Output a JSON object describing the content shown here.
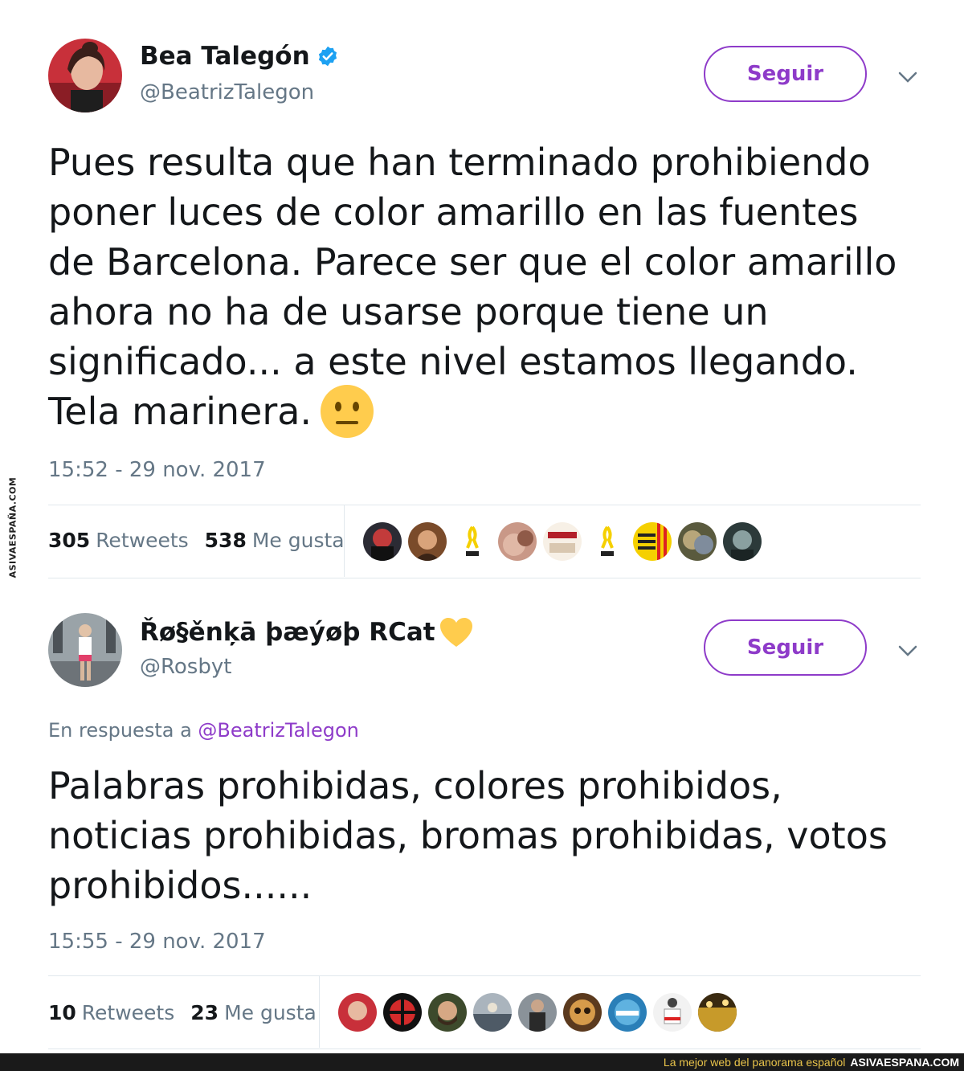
{
  "tweets": [
    {
      "name": "Bea Talegón",
      "handle": "@BeatrizTalegon",
      "follow_label": "Seguir",
      "text": "Pues resulta que han terminado prohibiendo\nponer luces de color amarillo en las fuentes\nde Barcelona. Parece ser que el color amarillo\nahora no ha de usarse porque tiene un\nsignificado... a este nivel estamos llegando.\nTela marinera.",
      "emoji": "neutral-face-icon",
      "timestamp": "15:52 - 29 nov. 2017",
      "retweets_count": "305",
      "retweets_label": "Retweets",
      "likes_count": "538",
      "likes_label": "Me gusta"
    },
    {
      "name": "Řø§ěnķā þæýøþ RCat",
      "handle": "@Rosbyt",
      "follow_label": "Seguir",
      "reply_prefix": "En respuesta a",
      "reply_mention": "@BeatrizTalegon",
      "text": "Palabras prohibidas, colores prohibidos,\nnoticias prohibidas, bromas prohibidas, votos\nprohibidos......",
      "timestamp": "15:55 - 29 nov. 2017",
      "retweets_count": "10",
      "retweets_label": "Retweets",
      "likes_count": "23",
      "likes_label": "Me gusta"
    }
  ],
  "watermark": {
    "side_text": "ASIVAESPAÑA.COM",
    "footer_tagline": "La mejor web del panorama español",
    "footer_site": "ASIVAESPANA.COM"
  },
  "colors": {
    "accent": "#8e3bc9",
    "muted": "#657786",
    "verified": "#1da1f2",
    "divider": "#e1e8ed"
  }
}
